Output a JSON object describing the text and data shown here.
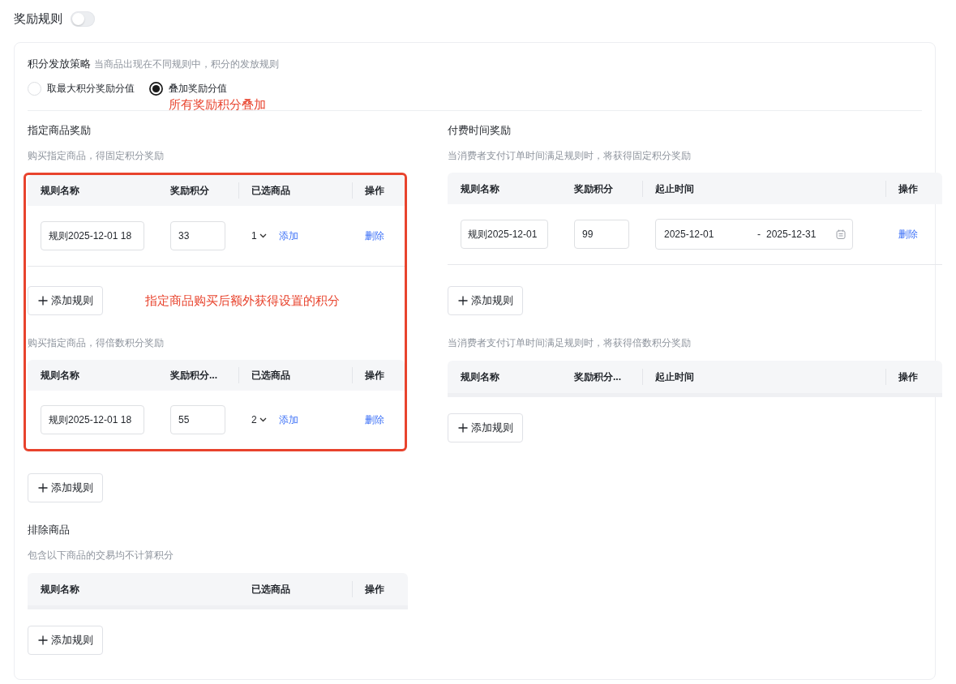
{
  "header": {
    "title": "奖励规则",
    "switch_on": false
  },
  "strategy": {
    "label": "积分发放策略",
    "hint": "当商品出现在不同规则中，积分的发放规则",
    "options": [
      {
        "label": "取最大积分奖励分值",
        "selected": false
      },
      {
        "label": "叠加奖励分值",
        "selected": true
      }
    ],
    "annotation": "所有奖励积分叠加"
  },
  "product_rewards": {
    "title": "指定商品奖励",
    "groups": [
      {
        "description": "购买指定商品，得固定积分奖励",
        "columns": [
          "规则名称",
          "奖励积分",
          "已选商品",
          "操作"
        ],
        "rows": [
          {
            "name": "规则2025-12-01 18",
            "points": "33",
            "selected_count": "1",
            "add_link": "添加",
            "delete_link": "删除"
          }
        ],
        "add_button": "添加规则"
      },
      {
        "description": "购买指定商品，得倍数积分奖励",
        "columns": [
          "规则名称",
          "奖励积分...",
          "已选商品",
          "操作"
        ],
        "rows": [
          {
            "name": "规则2025-12-01 18",
            "points": "55",
            "selected_count": "2",
            "add_link": "添加",
            "delete_link": "删除"
          }
        ],
        "add_button": "添加规则"
      }
    ],
    "annotation": "指定商品购买后额外获得设置的积分"
  },
  "time_rewards": {
    "title": "付费时间奖励",
    "groups": [
      {
        "description": "当消费者支付订单时间满足规则时，将获得固定积分奖励",
        "columns": [
          "规则名称",
          "奖励积分",
          "起止时间",
          "操作"
        ],
        "rows": [
          {
            "name": "规则2025-12-01",
            "points": "99",
            "start_date": "2025-12-01",
            "separator": "-",
            "end_date": "2025-12-31",
            "delete_link": "删除"
          }
        ],
        "add_button": "添加规则"
      },
      {
        "description": "当消费者支付订单时间满足规则时，将获得倍数积分奖励",
        "columns": [
          "规则名称",
          "奖励积分...",
          "起止时间",
          "操作"
        ],
        "add_button": "添加规则"
      }
    ]
  },
  "excluded_products": {
    "title": "排除商品",
    "description": "包含以下商品的交易均不计算积分",
    "columns": [
      "规则名称",
      "已选商品",
      "操作"
    ],
    "add_button": "添加规则"
  }
}
